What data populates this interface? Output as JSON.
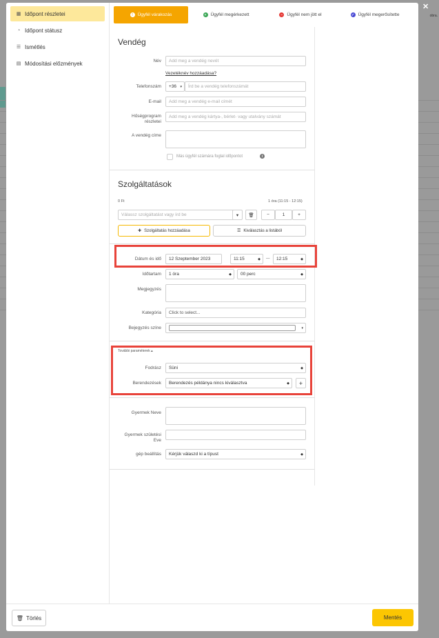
{
  "background": {
    "partial_text": "obra."
  },
  "modal": {
    "close_symbol": "✕"
  },
  "sidebar": {
    "items": [
      {
        "label": "Időpont részletei",
        "icon": "calendar-icon",
        "active": true
      },
      {
        "label": "Időpont státusz",
        "icon": "clock-icon",
        "active": false
      },
      {
        "label": "Ismétlés",
        "icon": "list-icon",
        "active": false
      },
      {
        "label": "Módosítási előzmények",
        "icon": "document-icon",
        "active": false
      }
    ]
  },
  "status_tabs": [
    {
      "label": "Ügyfél várakozás",
      "color": "#f5a500",
      "icon": "!"
    },
    {
      "label": "Ügyfél megérkezett",
      "color": "#3aa655",
      "icon": "+"
    },
    {
      "label": "Ügyfél nem jött el",
      "color": "#e53935",
      "icon": "−"
    },
    {
      "label": "Ügyfél megerősítette",
      "color": "#4a4ad4",
      "icon": "✓"
    }
  ],
  "guest": {
    "title": "Vendég",
    "name_label": "Név",
    "name_placeholder": "Add meg a vendég nevét",
    "add_surname": "Vezetéknév hozzáadása?",
    "phone_label": "Telefonszám",
    "phone_prefix": "+36",
    "phone_placeholder": "Írd be a vendég telefonszámát",
    "email_label": "E-mail",
    "email_placeholder": "Add meg a vendég e-mail címét",
    "loyalty_label": "Hűségprogram részletei",
    "loyalty_placeholder": "Add meg a vendég kártya-, bérlet- vagy utalvány számát",
    "address_label": "A vendég címe",
    "other_client": "Más ügyfél számára foglal időpontot"
  },
  "services": {
    "title": "Szolgáltatások",
    "price": "0 Ft",
    "duration_summary": "1 óra (11:15 - 12:15)",
    "service_placeholder": "Válassz szolgáltatást vagy írd be",
    "quantity": "1",
    "minus": "−",
    "plus": "+",
    "add_service": "Szolgáltatás hozzáadása",
    "from_list": "Kiválasztás a listából"
  },
  "details": {
    "date_label": "Dátum és idő",
    "date_value": "12 Szeptember 2023",
    "start_time": "11:15",
    "dash": "—",
    "end_time": "12:15",
    "duration_label": "Időtartam",
    "hours_value": "1 óra",
    "minutes_value": "00 perc",
    "note_label": "Megjegyzés",
    "category_label": "Kategória",
    "category_placeholder": "Click to select...",
    "color_label": "Bejegyzés színe"
  },
  "params": {
    "toggle": "További paraméterek ▴",
    "hairdresser_label": "Fodrász",
    "hairdresser_value": "Süni",
    "equipment_label": "Berendezések",
    "equipment_value": "Berendezés példánya nincs kiválasztva",
    "add": "+"
  },
  "custom": {
    "child_name_label": "Gyermek Neve",
    "child_birth_label": "Gyermek születési Eve",
    "machine_label": "gép beállítás",
    "machine_value": "Kérjük válaszd ki a típust"
  },
  "footer": {
    "delete": "Törlés",
    "save": "Mentés"
  }
}
